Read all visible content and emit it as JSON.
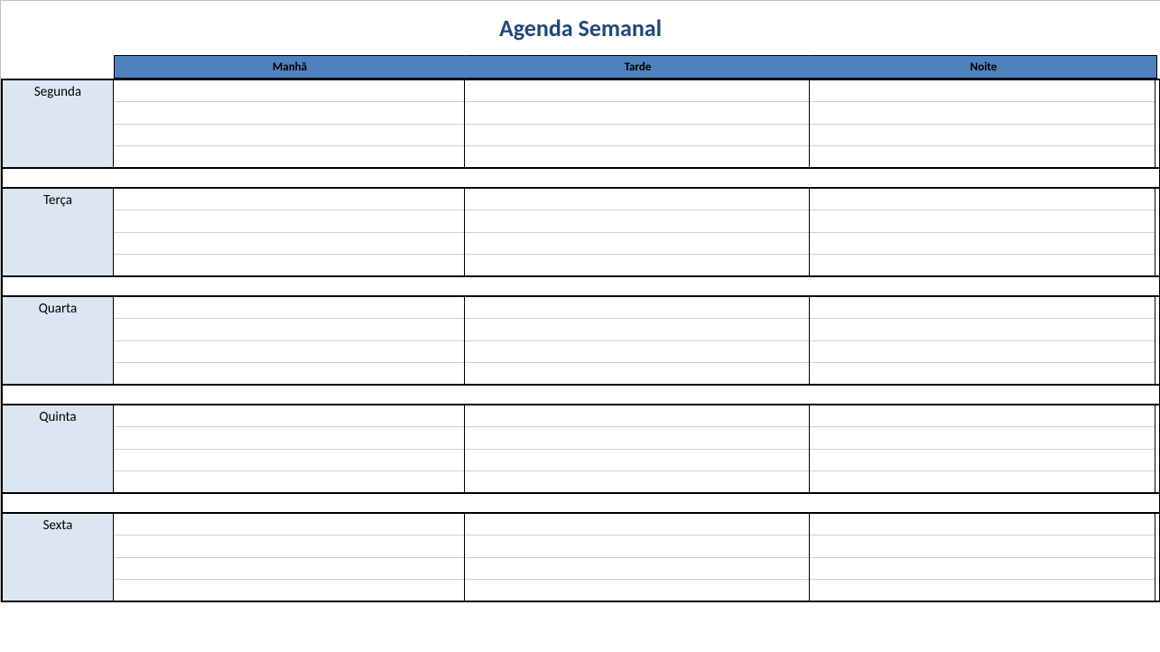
{
  "title": "Agenda Semanal",
  "periods": [
    "Manhã",
    "Tarde",
    "Noite"
  ],
  "days": [
    {
      "name": "Segunda",
      "slots": {
        "manha": [
          "",
          "",
          "",
          ""
        ],
        "tarde": [
          "",
          "",
          "",
          ""
        ],
        "noite": [
          "",
          "",
          "",
          ""
        ]
      }
    },
    {
      "name": "Terça",
      "slots": {
        "manha": [
          "",
          "",
          "",
          ""
        ],
        "tarde": [
          "",
          "",
          "",
          ""
        ],
        "noite": [
          "",
          "",
          "",
          ""
        ]
      }
    },
    {
      "name": "Quarta",
      "slots": {
        "manha": [
          "",
          "",
          "",
          ""
        ],
        "tarde": [
          "",
          "",
          "",
          ""
        ],
        "noite": [
          "",
          "",
          "",
          ""
        ]
      }
    },
    {
      "name": "Quinta",
      "slots": {
        "manha": [
          "",
          "",
          "",
          ""
        ],
        "tarde": [
          "",
          "",
          "",
          ""
        ],
        "noite": [
          "",
          "",
          "",
          ""
        ]
      }
    },
    {
      "name": "Sexta",
      "slots": {
        "manha": [
          "",
          "",
          "",
          ""
        ],
        "tarde": [
          "",
          "",
          "",
          ""
        ],
        "noite": [
          "",
          "",
          "",
          ""
        ]
      }
    }
  ]
}
